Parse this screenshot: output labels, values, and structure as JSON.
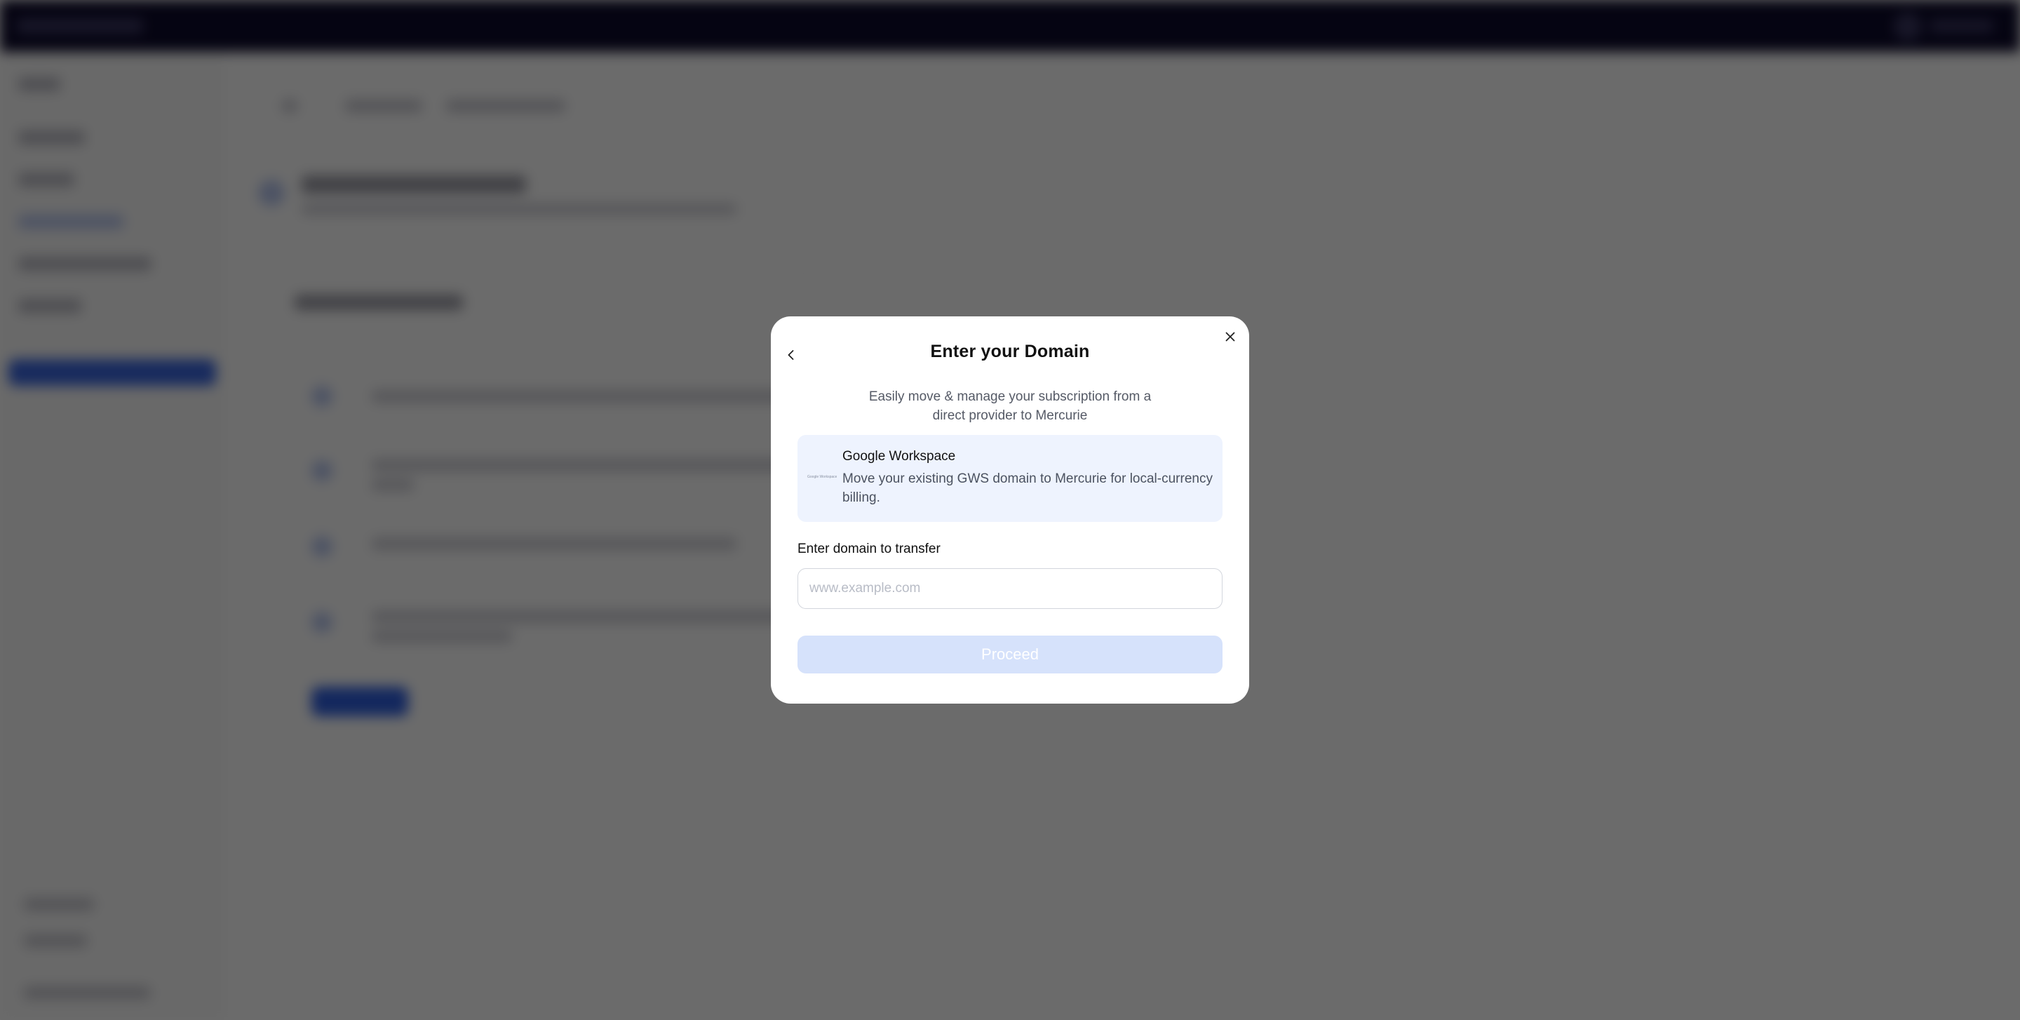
{
  "modal": {
    "title": "Enter your Domain",
    "description": "Easily move & manage your subscription from a direct provider to Mercurie",
    "provider": {
      "logo_text": "Google Workspace",
      "name": "Google Workspace",
      "description": "Move your existing GWS domain to Mercurie for local-currency billing."
    },
    "field_label": "Enter domain to transfer",
    "input": {
      "value": "",
      "placeholder": "www.example.com"
    },
    "proceed_label": "Proceed",
    "back_icon": "chevron-left-icon",
    "close_icon": "close-icon"
  },
  "colors": {
    "overlay": "#000000",
    "topbar": "#0d0a2b",
    "provider_card_bg": "#eef3fe",
    "proceed_disabled_bg": "#d6e2fb",
    "accent": "#2f5fe0"
  }
}
